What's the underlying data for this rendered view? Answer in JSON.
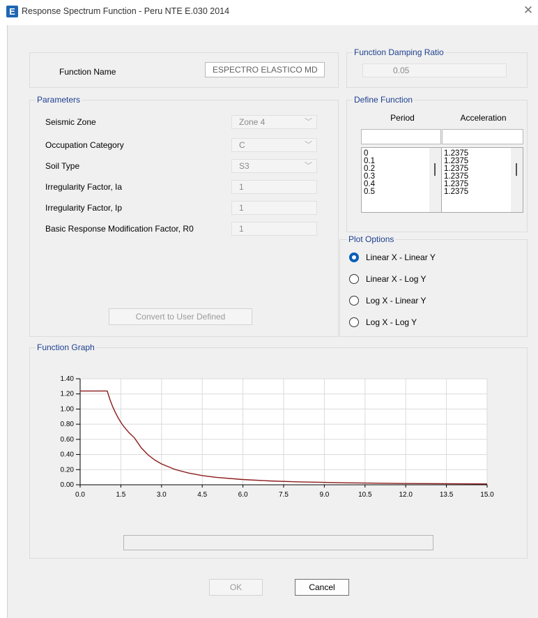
{
  "window": {
    "title": "Response Spectrum Function - Peru NTE E.030 2014",
    "icon_letter": "E",
    "close_glyph": "✕"
  },
  "function_name": {
    "label": "Function Name",
    "value": "ESPECTRO ELASTICO MD"
  },
  "damping": {
    "group_label": "Function Damping Ratio",
    "value": "0.05"
  },
  "parameters": {
    "group_label": "Parameters",
    "seismic_zone": {
      "label": "Seismic Zone",
      "value": "Zone 4"
    },
    "occupation_category": {
      "label": "Occupation Category",
      "value": "C"
    },
    "soil_type": {
      "label": "Soil Type",
      "value": "S3"
    },
    "irregularity_ia": {
      "label": "Irregularity Factor, Ia",
      "value": "1"
    },
    "irregularity_ip": {
      "label": "Irregularity Factor, Ip",
      "value": "1"
    },
    "r0": {
      "label": "Basic Response Modification Factor, R0",
      "value": "1"
    },
    "convert_button": "Convert to User Defined"
  },
  "define_function": {
    "group_label": "Define Function",
    "period_header": "Period",
    "acceleration_header": "Acceleration",
    "periods": [
      "0",
      "0.1",
      "0.2",
      "0.3",
      "0.4",
      "0.5"
    ],
    "accelerations": [
      "1.2375",
      "1.2375",
      "1.2375",
      "1.2375",
      "1.2375",
      "1.2375"
    ]
  },
  "plot_options": {
    "group_label": "Plot Options",
    "options": [
      "Linear X - Linear Y",
      "Linear X - Log Y",
      "Log X - Linear Y",
      "Log X - Log Y"
    ],
    "selected": "Linear X - Linear Y"
  },
  "graph": {
    "group_label": "Function Graph",
    "status_text": ""
  },
  "chart_data": {
    "type": "line",
    "title": "",
    "xlabel": "",
    "ylabel": "",
    "xlim": [
      0,
      15
    ],
    "ylim": [
      0,
      1.4
    ],
    "xticks": [
      "0.0",
      "1.5",
      "3.0",
      "4.5",
      "6.0",
      "7.5",
      "9.0",
      "10.5",
      "12.0",
      "13.5",
      "15.0"
    ],
    "yticks": [
      "0.00",
      "0.20",
      "0.40",
      "0.60",
      "0.80",
      "1.00",
      "1.20",
      "1.40"
    ],
    "grid": true,
    "series": [
      {
        "color": "#8b1a1a",
        "x": [
          0,
          1.0,
          1.1,
          1.2,
          1.3,
          1.4,
          1.5,
          1.6,
          1.8,
          2.0,
          2.25,
          2.5,
          2.75,
          3.0,
          3.5,
          4.0,
          4.5,
          5.0,
          6.0,
          7.0,
          8.0,
          9.0,
          10.0,
          12.0,
          15.0
        ],
        "y": [
          1.2375,
          1.2375,
          1.125,
          1.031,
          0.952,
          0.884,
          0.825,
          0.773,
          0.688,
          0.619,
          0.489,
          0.396,
          0.327,
          0.275,
          0.202,
          0.155,
          0.122,
          0.099,
          0.069,
          0.051,
          0.039,
          0.031,
          0.025,
          0.017,
          0.011
        ]
      }
    ]
  },
  "buttons": {
    "ok": "OK",
    "cancel": "Cancel"
  }
}
